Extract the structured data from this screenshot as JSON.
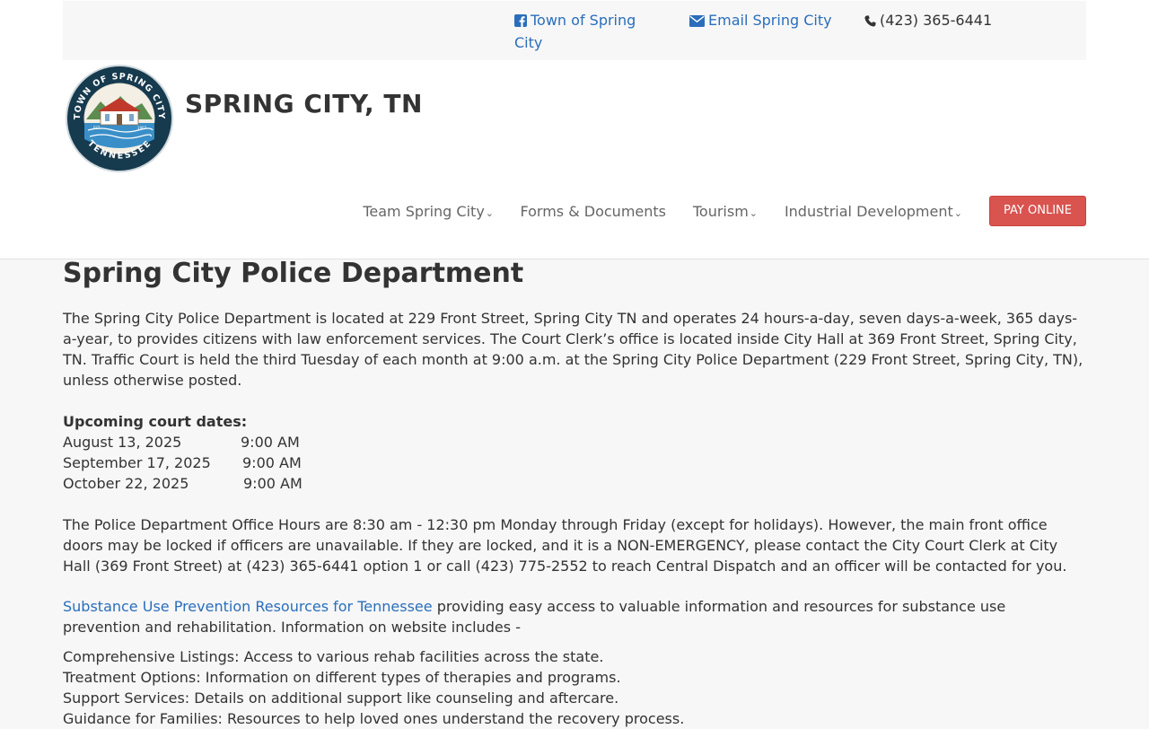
{
  "topbar": {
    "facebook_label": "Town of Spring City",
    "email_label": "Email Spring City",
    "phone_label": "(423) 365-6441"
  },
  "header": {
    "logo": {
      "ring_text_top": "TOWN OF SPRING CITY",
      "ring_text_bottom": "TENNESSEE",
      "est_left": "EST.",
      "est_right": "1907"
    },
    "site_title": "SPRING CITY, TN"
  },
  "nav": {
    "team": "Team Spring City",
    "forms": "Forms & Documents",
    "tourism": "Tourism",
    "industrial": "Industrial Development",
    "pay_online": "PAY ONLINE"
  },
  "main": {
    "title": "Spring City Police Department",
    "intro": "The Spring City Police Department is located at 229 Front Street, Spring City TN and operates 24 hours-a-day, seven days-a-week, 365 days-a-year, to provides citizens with law enforcement services.  The Court Clerk’s office is located inside City Hall at 369 Front Street, Spring City, TN.  Traffic Court is held the third Tuesday of each month at 9:00 a.m. at the Spring City Police Department (229 Front Street, Spring City, TN), unless otherwise posted.",
    "court_heading": "Upcoming court dates:",
    "court_dates": [
      {
        "date": "August 13, 2025",
        "time": "9:00 AM"
      },
      {
        "date": "September 17, 2025",
        "time": "9:00 AM"
      },
      {
        "date": "October 22, 2025",
        "time": "9:00 AM"
      }
    ],
    "hours": "The Police Department Office Hours are 8:30 am - 12:30 pm Monday through Friday (except for holidays).  However, the main front office doors may be locked if officers are unavailable.  If they are locked, and it is a NON-EMERGENCY, please contact the City Court Clerk at City Hall (369 Front Street) at (423) 365-6441 option 1 or call (423) 775-2552 to reach Central Dispatch and an officer will be contacted for you.",
    "resources_link": "Substance Use Prevention Resources for Tennessee",
    "resources_text": " providing easy access to valuable information and resources for substance use prevention and rehabilitation.  Information on website includes -",
    "resource_items": [
      "Comprehensive Listings: Access to various rehab facilities across the state.",
      "Treatment Options: Information on different types of therapies and programs.",
      "Support Services: Details on additional support like counseling and aftercare.",
      "Guidance for Families: Resources to help loved ones understand the recovery process."
    ]
  },
  "colors": {
    "link": "#2a6ebb",
    "pay_button": "#d9534f",
    "text": "#333333",
    "nav_text": "#666666",
    "background": "#f7f7f7"
  }
}
